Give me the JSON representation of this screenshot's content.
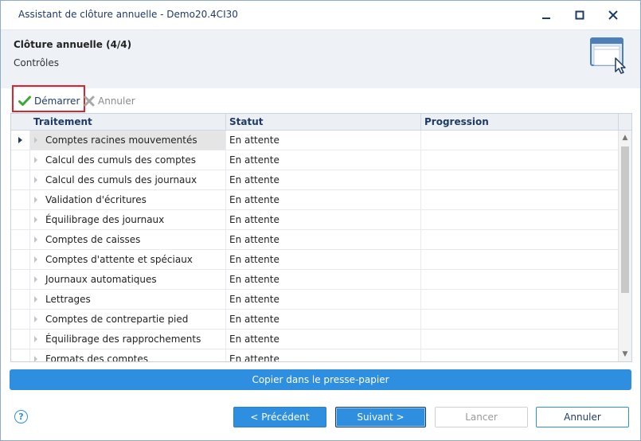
{
  "window": {
    "title": "Assistant de clôture annuelle - Demo20.4CI30",
    "controls": {
      "minimize": "▁",
      "maximize": "☐",
      "close": "✕"
    }
  },
  "header": {
    "title": "Clôture annuelle (4/4)",
    "subtitle": "Contrôles",
    "icon": "window-cursor-icon"
  },
  "toolbar": {
    "start_label": "Démarrer",
    "start_icon": "checkmark-icon",
    "cancel_label": "Annuler",
    "cancel_icon": "cross-icon"
  },
  "grid": {
    "columns": [
      "Traitement",
      "Statut",
      "Progression"
    ],
    "rows": [
      {
        "traitement": "Comptes racines mouvementés",
        "statut": "En attente",
        "progression": "",
        "selected": true
      },
      {
        "traitement": "Calcul des cumuls des comptes",
        "statut": "En attente",
        "progression": ""
      },
      {
        "traitement": "Calcul des cumuls des journaux",
        "statut": "En attente",
        "progression": ""
      },
      {
        "traitement": "Validation d'écritures",
        "statut": "En attente",
        "progression": ""
      },
      {
        "traitement": "Équilibrage des journaux",
        "statut": "En attente",
        "progression": ""
      },
      {
        "traitement": "Comptes de caisses",
        "statut": "En attente",
        "progression": ""
      },
      {
        "traitement": "Comptes d'attente et spéciaux",
        "statut": "En attente",
        "progression": ""
      },
      {
        "traitement": "Journaux automatiques",
        "statut": "En attente",
        "progression": ""
      },
      {
        "traitement": "Lettrages",
        "statut": "En attente",
        "progression": ""
      },
      {
        "traitement": "Comptes de contrepartie pied",
        "statut": "En attente",
        "progression": ""
      },
      {
        "traitement": "Équilibrage des rapprochements",
        "statut": "En attente",
        "progression": ""
      },
      {
        "traitement": "Formats des comptes",
        "statut": "En attente",
        "progression": ""
      }
    ]
  },
  "actions": {
    "copy_label": "Copier dans le presse-papier",
    "help_icon": "?",
    "prev_label": "< Précédent",
    "next_label": "Suivant >",
    "lancer_label": "Lancer",
    "annuler_label": "Annuler"
  },
  "colors": {
    "accent": "#2e8fe0",
    "title_text": "#1f3b63",
    "highlight_outline": "#d7262f",
    "check_green": "#3aa935"
  }
}
